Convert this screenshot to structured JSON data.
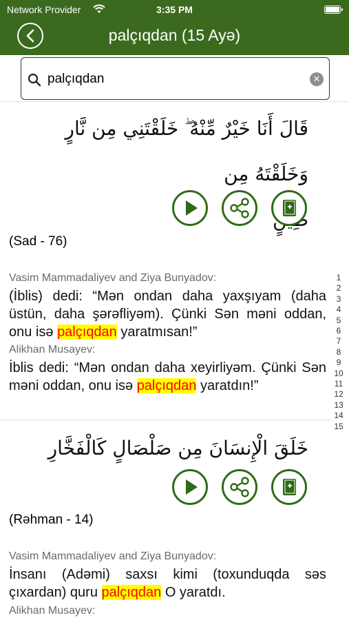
{
  "status": {
    "carrier": "Network Provider",
    "time": "3:35 PM"
  },
  "header": {
    "title": "palçıqdan (15 Ayə)",
    "back_icon": "chevron-left-icon",
    "color": "#3b6a1f"
  },
  "search": {
    "value": "palçıqdan",
    "icon": "search-icon",
    "clear_icon": "clear-icon"
  },
  "colors": {
    "accent": "#2f6a17",
    "highlight_bg": "#ffff00",
    "highlight_fg": "#ff0000"
  },
  "results": [
    {
      "arabic_line1": "قَالَ أَنَا خَيْرٌ مِّنْهُ ۖ خَلَقْتَنِي مِن نَّارٍ وَخَلَقْتَهُ مِن",
      "arabic_line2": "طِينٍ",
      "reference": "(Sad - 76)",
      "translations": [
        {
          "author": "Vasim Mammadaliyev and Ziya Bunyadov:",
          "before": "(İblis) dedi: “Mən ondan daha yaxşıyam (daha üstün, daha şərəfliyəm). Çünki Sən məni oddan, onu isə ",
          "match": "palçıqdan",
          "after": " yaratmısan!”"
        },
        {
          "author": "Alikhan Musayev:",
          "before": "İblis dedi: “Mən ondan daha xeyirliyəm. Çünki Sən məni oddan, onu isə ",
          "match": "palçıqdan",
          "after": " yaratdın!”"
        }
      ]
    },
    {
      "arabic_line1": "خَلَقَ الْإِنسَانَ مِن صَلْصَالٍ كَالْفَخَّارِ",
      "reference": "(Rəhman - 14)",
      "translations": [
        {
          "author": "Vasim Mammadaliyev and Ziya Bunyadov:",
          "before": "İnsanı (Adəmi) saxsı kimi (toxunduqda səs çıxardan) quru ",
          "match": "palçıqdan",
          "after": " O yaratdı."
        },
        {
          "author": "Alikhan Musayev:"
        }
      ]
    }
  ],
  "action_icons": [
    "play-icon",
    "share-icon",
    "bookmark-book-icon"
  ],
  "index_numbers": [
    "1",
    "2",
    "3",
    "4",
    "5",
    "6",
    "7",
    "8",
    "9",
    "10",
    "11",
    "12",
    "13",
    "14",
    "15"
  ]
}
